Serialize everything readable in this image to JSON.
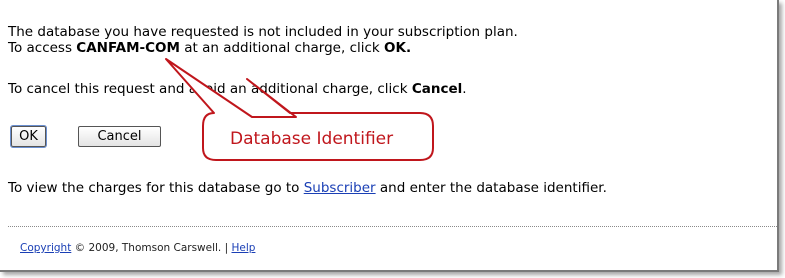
{
  "message": {
    "line1": "The database you have requested is not included in your subscription plan.",
    "line2_prefix": "To access ",
    "line2_db": "CANFAM-COM",
    "line2_middle": " at an additional charge, click ",
    "line2_ok": "OK.",
    "line3_prefix": "To cancel this request and avoid an additional charge, click ",
    "line3_cancel": "Cancel",
    "line3_suffix": ".",
    "line4_prefix": "To view the charges for this database go to ",
    "line4_link": "Subscriber",
    "line4_suffix": " and enter the database identifier."
  },
  "buttons": {
    "ok_label": "OK",
    "cancel_label": "Cancel"
  },
  "callout": {
    "label": "Database Identifier",
    "color": "#c0161c"
  },
  "footer": {
    "copyright_link": "Copyright",
    "copyright_text": " © 2009, Thomson Carswell. | ",
    "help_link": "Help"
  }
}
